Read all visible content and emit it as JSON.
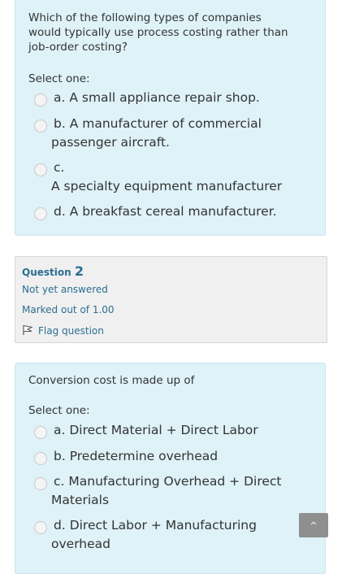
{
  "question1": {
    "text": "Which of the following types of companies would typically use process costing rather than job-order costing?",
    "select_label": "Select one:",
    "options": [
      {
        "letter_label": "a. A small appliance repair shop.",
        "cont": ""
      },
      {
        "letter_label": "b. A manufacturer of commercial",
        "cont": "passenger aircraft."
      },
      {
        "letter_label": "c.",
        "cont": "A specialty equipment manufacturer"
      },
      {
        "letter_label": "d. A breakfast cereal manufacturer.",
        "cont": ""
      }
    ]
  },
  "question2_info": {
    "title": "Question",
    "number": "2",
    "status": "Not yet answered",
    "marks": "Marked out of 1.00",
    "flag_label": "Flag question"
  },
  "question2": {
    "text": "Conversion cost is made up of",
    "select_label": "Select one:",
    "options": [
      {
        "letter_label": "a. Direct Material + Direct Labor",
        "cont": ""
      },
      {
        "letter_label": "b. Predetermine overhead",
        "cont": ""
      },
      {
        "letter_label": "c. Manufacturing Overhead + Direct",
        "cont": "Materials"
      },
      {
        "letter_label": "d. Direct Labor + Manufacturing",
        "cont": "overhead"
      }
    ]
  },
  "scroll_top": {
    "icon": "chevron-up-icon",
    "glyph": "^"
  }
}
